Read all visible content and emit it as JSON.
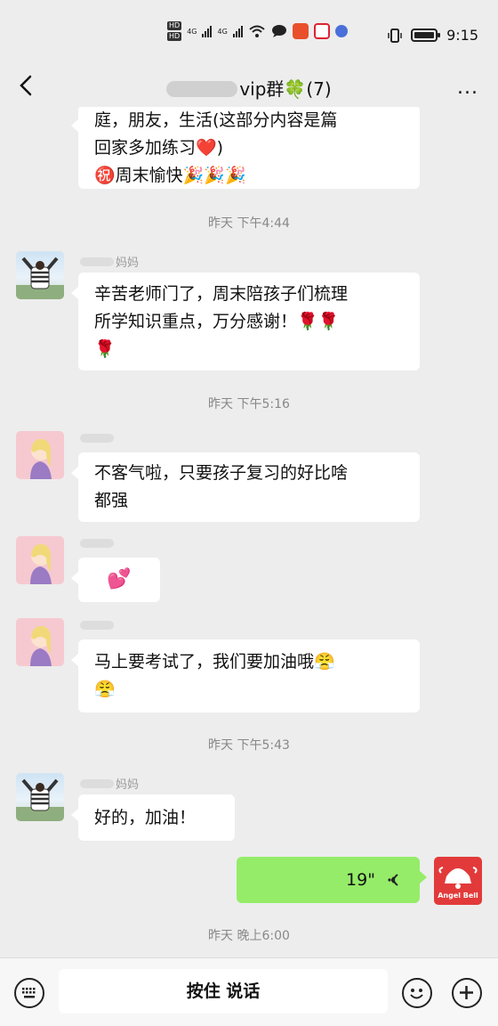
{
  "status_bar": {
    "hd1": "HD",
    "hd2": "HD",
    "net1": "4G",
    "net2": "4G",
    "time": "9:15"
  },
  "header": {
    "title": "vip群🍀(7)",
    "more_label": "..."
  },
  "messages": [
    {
      "lines": [
        "庭，朋友，生活(这部分内容是篇",
        "回家多加练习❤️)",
        "㊗️周末愉快🎉🎉🎉"
      ]
    },
    {
      "time": "昨天 下午4:44"
    },
    {
      "sender": "妈妈",
      "lines": [
        "辛苦老师门了，周末陪孩子们梳理",
        "所学知识重点，万分感谢！🌹🌹",
        "🌹"
      ]
    },
    {
      "time": "昨天 下午5:16"
    },
    {
      "lines": [
        "不客气啦，只要孩子复习的好比啥",
        "都强"
      ]
    },
    {
      "text": "💕"
    },
    {
      "lines": [
        "马上要考试了，我们要加油哦😤",
        "😤"
      ]
    },
    {
      "time": "昨天 下午5:43"
    },
    {
      "sender": "妈妈",
      "text": "好的，加油！"
    },
    {
      "voice_duration": "19\"",
      "avatar_brand": "Angel Bell"
    },
    {
      "time": "昨天 晚上6:00"
    }
  ],
  "input_bar": {
    "hold_to_talk": "按住 说话"
  },
  "colors": {
    "background": "#ededed",
    "own_bubble": "#95ec69",
    "other_bubble": "#ffffff"
  }
}
